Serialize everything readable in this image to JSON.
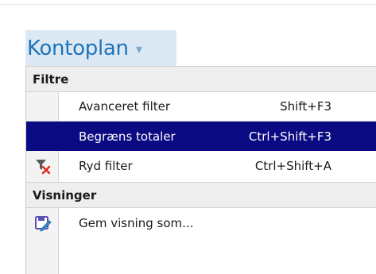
{
  "header": {
    "title": "Kontoplan",
    "caret_icon": "chevron-down-icon"
  },
  "menu": {
    "sections": [
      {
        "label": "Filtre",
        "items": [
          {
            "label": "Avanceret filter",
            "shortcut": "Shift+F3",
            "icon": null,
            "selected": false
          },
          {
            "label": "Begræns totaler",
            "shortcut": "Ctrl+Shift+F3",
            "icon": null,
            "selected": true
          },
          {
            "label": "Ryd filter",
            "shortcut": "Ctrl+Shift+A",
            "icon": "clear-filter-icon",
            "selected": false
          }
        ]
      },
      {
        "label": "Visninger",
        "items": [
          {
            "label": "Gem visning som...",
            "shortcut": "",
            "icon": "save-view-icon",
            "selected": false
          }
        ]
      }
    ]
  },
  "colors": {
    "title_text": "#1e73b9",
    "title_bg": "#dce9f5",
    "selection_bg": "#0a0a82",
    "header_bg": "#eeeeee",
    "gutter_bg": "#f3f3f3"
  }
}
